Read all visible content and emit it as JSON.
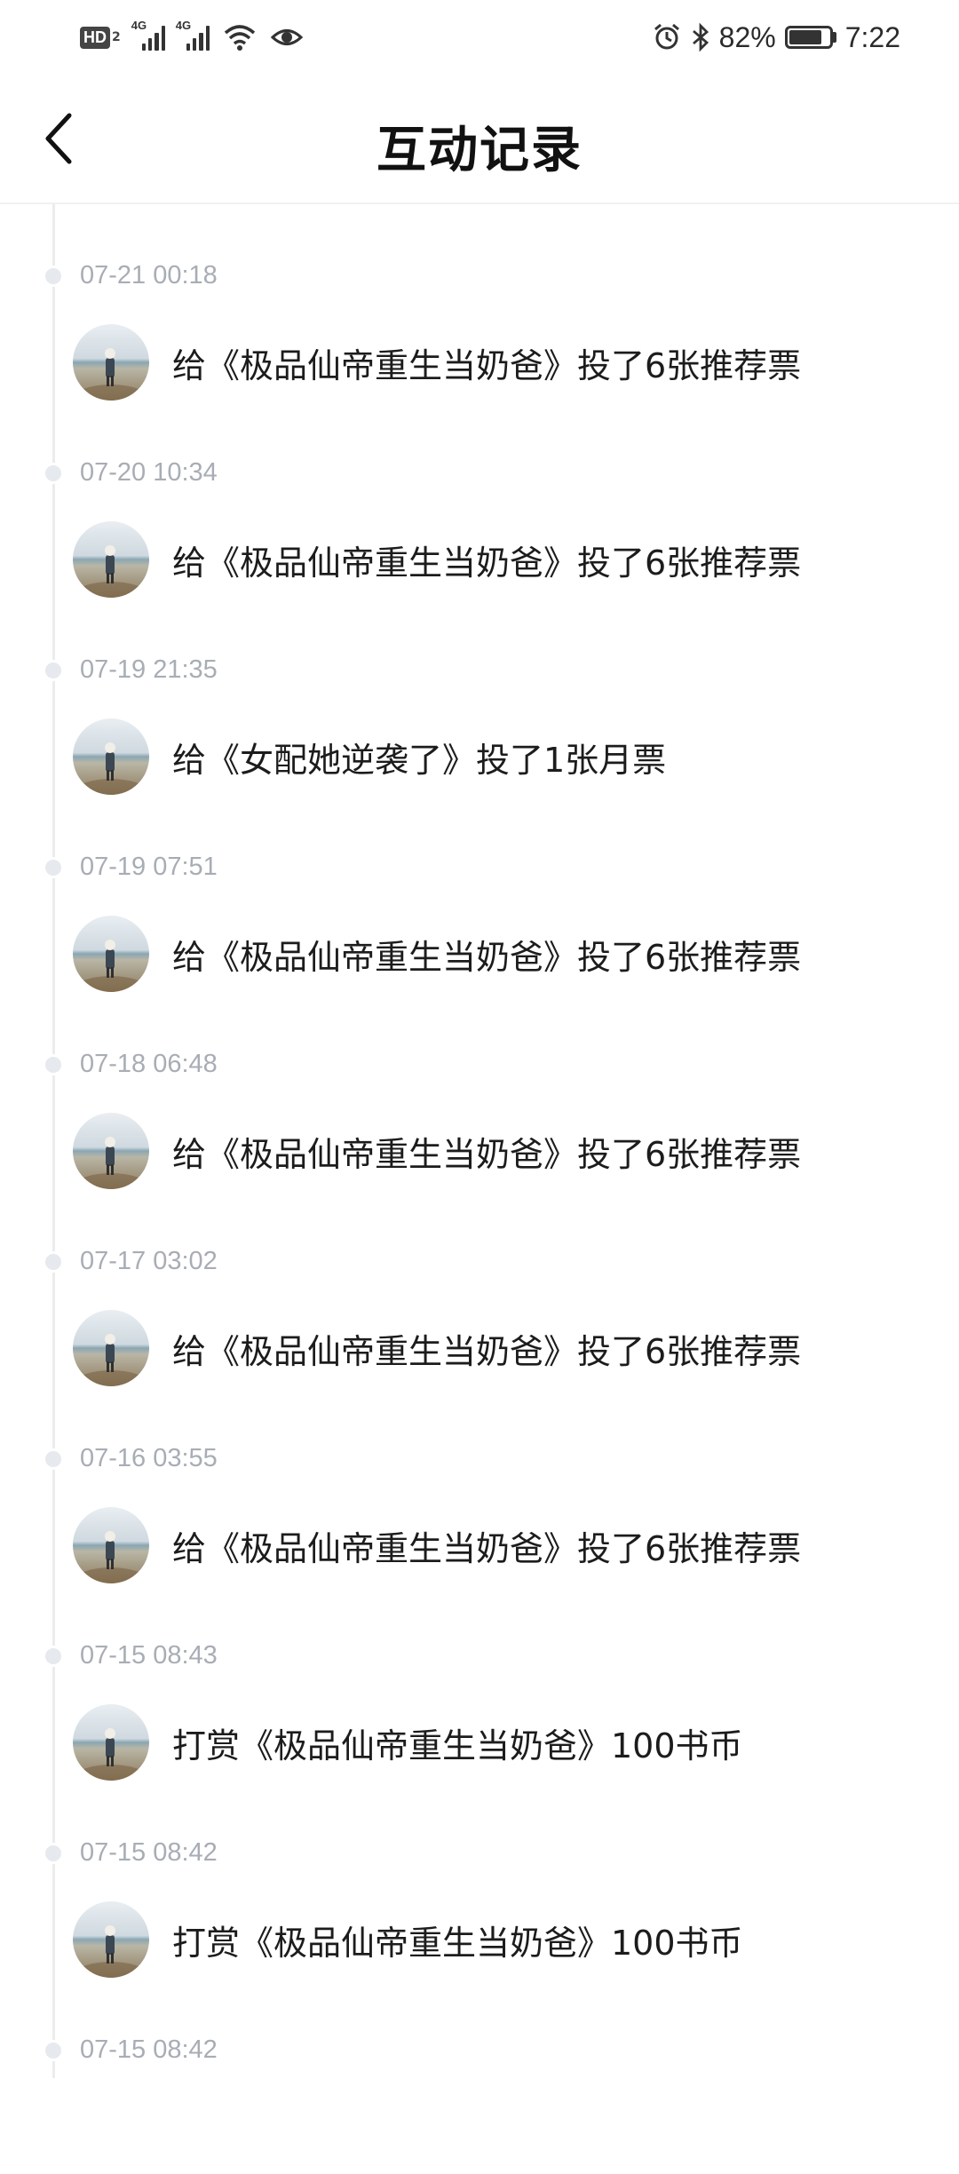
{
  "status_bar": {
    "network_badge": "HD",
    "network_badge_sub": "2",
    "signal_1_tag": "4G",
    "signal_2_tag": "4G",
    "battery_percent": "82%",
    "battery_level": 0.82,
    "time": "7:22"
  },
  "header": {
    "title": "互动记录",
    "back_icon": "chevron-left-icon"
  },
  "records": [
    {
      "time": "07-21 00:18",
      "text": "给《极品仙帝重生当奶爸》投了6张推荐票"
    },
    {
      "time": "07-20 10:34",
      "text": "给《极品仙帝重生当奶爸》投了6张推荐票"
    },
    {
      "time": "07-19 21:35",
      "text": "给《女配她逆袭了》投了1张月票"
    },
    {
      "time": "07-19 07:51",
      "text": "给《极品仙帝重生当奶爸》投了6张推荐票"
    },
    {
      "time": "07-18 06:48",
      "text": "给《极品仙帝重生当奶爸》投了6张推荐票"
    },
    {
      "time": "07-17 03:02",
      "text": "给《极品仙帝重生当奶爸》投了6张推荐票"
    },
    {
      "time": "07-16 03:55",
      "text": "给《极品仙帝重生当奶爸》投了6张推荐票"
    },
    {
      "time": "07-15 08:43",
      "text": "打赏《极品仙帝重生当奶爸》100书币"
    },
    {
      "time": "07-15 08:42",
      "text": "打赏《极品仙帝重生当奶爸》100书币"
    },
    {
      "time": "07-15 08:42",
      "text": ""
    }
  ],
  "colors": {
    "timestamp": "#a8adb5",
    "timeline_line": "#ececec",
    "text": "#1c1c1c"
  }
}
